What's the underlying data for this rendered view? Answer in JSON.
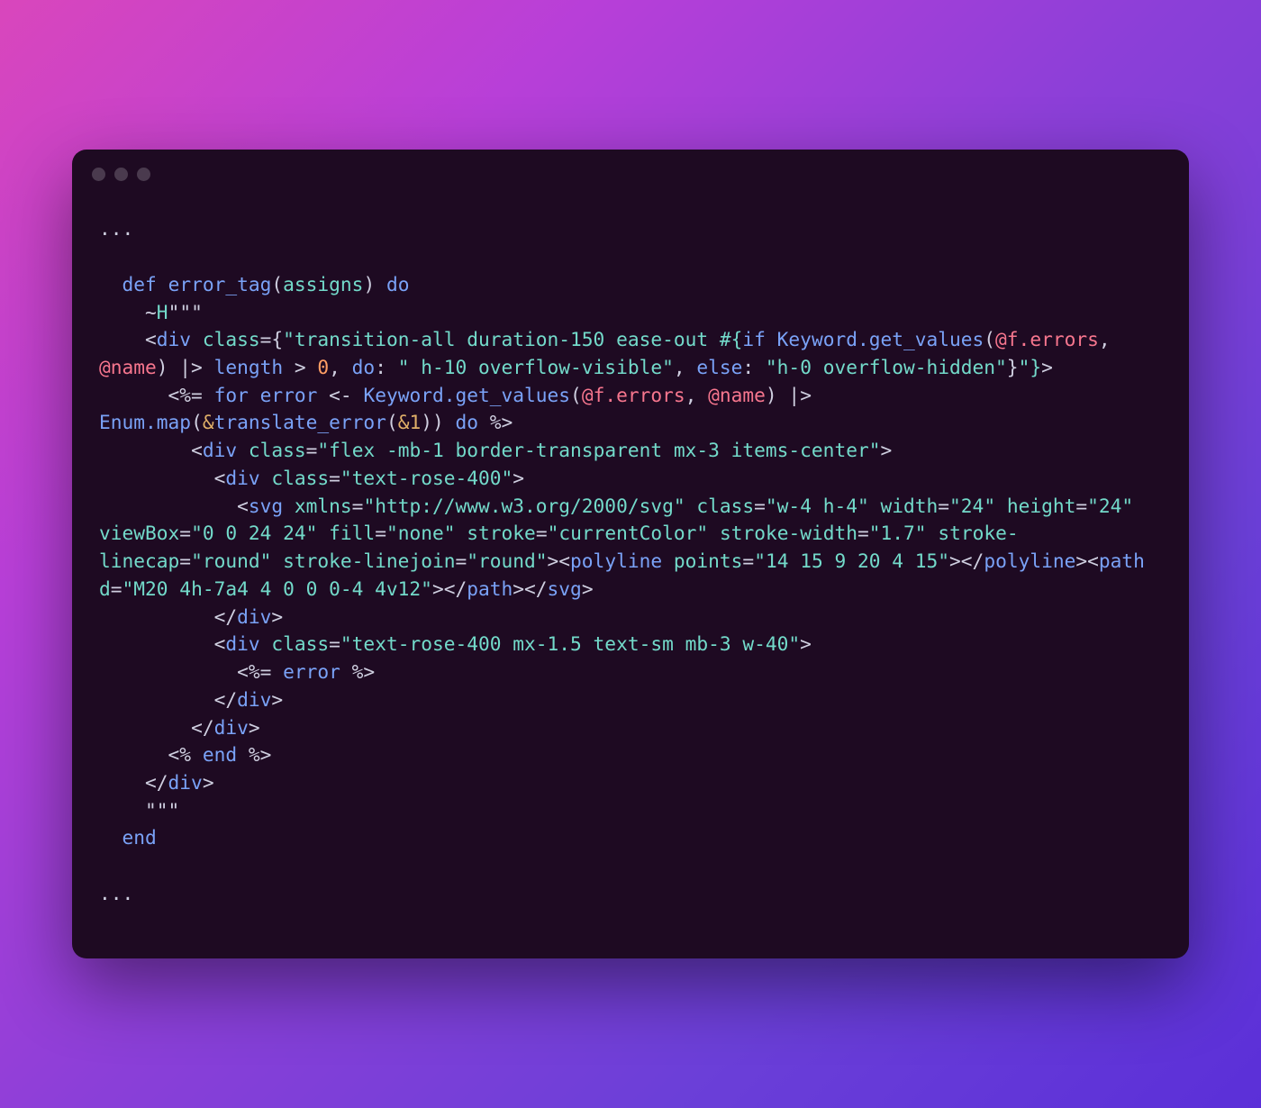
{
  "window": {
    "trafficLights": 3
  },
  "code": {
    "tokens": [
      {
        "t": "...",
        "c": "cmt"
      },
      {
        "t": "\n\n",
        "c": "pl"
      },
      {
        "t": "  ",
        "c": "pl"
      },
      {
        "t": "def",
        "c": "kw"
      },
      {
        "t": " ",
        "c": "pl"
      },
      {
        "t": "error_tag",
        "c": "fn"
      },
      {
        "t": "(",
        "c": "pun"
      },
      {
        "t": "assigns",
        "c": "str"
      },
      {
        "t": ") ",
        "c": "pun"
      },
      {
        "t": "do",
        "c": "kw"
      },
      {
        "t": "\n",
        "c": "pl"
      },
      {
        "t": "    ~",
        "c": "pl"
      },
      {
        "t": "H",
        "c": "str"
      },
      {
        "t": "\"\"\"",
        "c": "pl"
      },
      {
        "t": "\n",
        "c": "pl"
      },
      {
        "t": "    <",
        "c": "pun"
      },
      {
        "t": "div",
        "c": "tag"
      },
      {
        "t": " ",
        "c": "pl"
      },
      {
        "t": "class",
        "c": "str"
      },
      {
        "t": "={",
        "c": "pun"
      },
      {
        "t": "\"transition-all duration-150 ease-out #{",
        "c": "str"
      },
      {
        "t": "if",
        "c": "kw"
      },
      {
        "t": " ",
        "c": "pl"
      },
      {
        "t": "Keyword.get_values",
        "c": "fn"
      },
      {
        "t": "(",
        "c": "pun"
      },
      {
        "t": "@f.errors",
        "c": "at"
      },
      {
        "t": ", ",
        "c": "pun"
      },
      {
        "t": "@name",
        "c": "at"
      },
      {
        "t": ") |> ",
        "c": "pun"
      },
      {
        "t": "length",
        "c": "fn"
      },
      {
        "t": " > ",
        "c": "pun"
      },
      {
        "t": "0",
        "c": "num"
      },
      {
        "t": ", ",
        "c": "pun"
      },
      {
        "t": "do",
        "c": "kw"
      },
      {
        "t": ": ",
        "c": "pun"
      },
      {
        "t": "\" h-10 overflow-visible\"",
        "c": "str"
      },
      {
        "t": ", ",
        "c": "pun"
      },
      {
        "t": "else",
        "c": "kw"
      },
      {
        "t": ": ",
        "c": "pun"
      },
      {
        "t": "\"h-0 overflow-hidden\"",
        "c": "str"
      },
      {
        "t": "}",
        "c": "pun"
      },
      {
        "t": "\"}",
        "c": "str"
      },
      {
        "t": ">",
        "c": "pun"
      },
      {
        "t": "\n",
        "c": "pl"
      },
      {
        "t": "      <%= ",
        "c": "pun"
      },
      {
        "t": "for",
        "c": "kw"
      },
      {
        "t": " ",
        "c": "pl"
      },
      {
        "t": "error",
        "c": "fn"
      },
      {
        "t": " <- ",
        "c": "pun"
      },
      {
        "t": "Keyword.get_values",
        "c": "fn"
      },
      {
        "t": "(",
        "c": "pun"
      },
      {
        "t": "@f.errors",
        "c": "at"
      },
      {
        "t": ", ",
        "c": "pun"
      },
      {
        "t": "@name",
        "c": "at"
      },
      {
        "t": ") |> ",
        "c": "pun"
      },
      {
        "t": "Enum.map",
        "c": "fn"
      },
      {
        "t": "(",
        "c": "pun"
      },
      {
        "t": "&",
        "c": "amp"
      },
      {
        "t": "translate_error",
        "c": "fn"
      },
      {
        "t": "(",
        "c": "pun"
      },
      {
        "t": "&1",
        "c": "amp"
      },
      {
        "t": ")) ",
        "c": "pun"
      },
      {
        "t": "do",
        "c": "kw"
      },
      {
        "t": " %>",
        "c": "pun"
      },
      {
        "t": "\n",
        "c": "pl"
      },
      {
        "t": "        <",
        "c": "pun"
      },
      {
        "t": "div",
        "c": "tag"
      },
      {
        "t": " ",
        "c": "pl"
      },
      {
        "t": "class",
        "c": "str"
      },
      {
        "t": "=",
        "c": "pun"
      },
      {
        "t": "\"flex -mb-1 border-transparent mx-3 items-center\"",
        "c": "str"
      },
      {
        "t": ">",
        "c": "pun"
      },
      {
        "t": "\n",
        "c": "pl"
      },
      {
        "t": "          <",
        "c": "pun"
      },
      {
        "t": "div",
        "c": "tag"
      },
      {
        "t": " ",
        "c": "pl"
      },
      {
        "t": "class",
        "c": "str"
      },
      {
        "t": "=",
        "c": "pun"
      },
      {
        "t": "\"text-rose-400\"",
        "c": "str"
      },
      {
        "t": ">",
        "c": "pun"
      },
      {
        "t": "\n",
        "c": "pl"
      },
      {
        "t": "            <",
        "c": "pun"
      },
      {
        "t": "svg",
        "c": "tag"
      },
      {
        "t": " ",
        "c": "pl"
      },
      {
        "t": "xmlns",
        "c": "str"
      },
      {
        "t": "=",
        "c": "pun"
      },
      {
        "t": "\"http://www.w3.org/2000/svg\"",
        "c": "str"
      },
      {
        "t": " ",
        "c": "pl"
      },
      {
        "t": "class",
        "c": "str"
      },
      {
        "t": "=",
        "c": "pun"
      },
      {
        "t": "\"w-4 h-4\"",
        "c": "str"
      },
      {
        "t": " ",
        "c": "pl"
      },
      {
        "t": "width",
        "c": "str"
      },
      {
        "t": "=",
        "c": "pun"
      },
      {
        "t": "\"24\"",
        "c": "str"
      },
      {
        "t": " ",
        "c": "pl"
      },
      {
        "t": "height",
        "c": "str"
      },
      {
        "t": "=",
        "c": "pun"
      },
      {
        "t": "\"24\"",
        "c": "str"
      },
      {
        "t": " ",
        "c": "pl"
      },
      {
        "t": "viewBox",
        "c": "str"
      },
      {
        "t": "=",
        "c": "pun"
      },
      {
        "t": "\"0 0 24 24\"",
        "c": "str"
      },
      {
        "t": " ",
        "c": "pl"
      },
      {
        "t": "fill",
        "c": "str"
      },
      {
        "t": "=",
        "c": "pun"
      },
      {
        "t": "\"none\"",
        "c": "str"
      },
      {
        "t": " ",
        "c": "pl"
      },
      {
        "t": "stroke",
        "c": "str"
      },
      {
        "t": "=",
        "c": "pun"
      },
      {
        "t": "\"currentColor\"",
        "c": "str"
      },
      {
        "t": " ",
        "c": "pl"
      },
      {
        "t": "stroke-width",
        "c": "str"
      },
      {
        "t": "=",
        "c": "pun"
      },
      {
        "t": "\"1.7\"",
        "c": "str"
      },
      {
        "t": " ",
        "c": "pl"
      },
      {
        "t": "stroke-linecap",
        "c": "str"
      },
      {
        "t": "=",
        "c": "pun"
      },
      {
        "t": "\"round\"",
        "c": "str"
      },
      {
        "t": " ",
        "c": "pl"
      },
      {
        "t": "stroke-linejoin",
        "c": "str"
      },
      {
        "t": "=",
        "c": "pun"
      },
      {
        "t": "\"round\"",
        "c": "str"
      },
      {
        "t": "><",
        "c": "pun"
      },
      {
        "t": "polyline",
        "c": "tag"
      },
      {
        "t": " ",
        "c": "pl"
      },
      {
        "t": "points",
        "c": "str"
      },
      {
        "t": "=",
        "c": "pun"
      },
      {
        "t": "\"14 15 9 20 4 15\"",
        "c": "str"
      },
      {
        "t": "></",
        "c": "pun"
      },
      {
        "t": "polyline",
        "c": "tag"
      },
      {
        "t": "><",
        "c": "pun"
      },
      {
        "t": "path",
        "c": "tag"
      },
      {
        "t": " ",
        "c": "pl"
      },
      {
        "t": "d",
        "c": "str"
      },
      {
        "t": "=",
        "c": "pun"
      },
      {
        "t": "\"M20 4h-7a4 4 0 0 0-4 4v12\"",
        "c": "str"
      },
      {
        "t": "></",
        "c": "pun"
      },
      {
        "t": "path",
        "c": "tag"
      },
      {
        "t": "></",
        "c": "pun"
      },
      {
        "t": "svg",
        "c": "tag"
      },
      {
        "t": ">",
        "c": "pun"
      },
      {
        "t": "\n",
        "c": "pl"
      },
      {
        "t": "          </",
        "c": "pun"
      },
      {
        "t": "div",
        "c": "tag"
      },
      {
        "t": ">",
        "c": "pun"
      },
      {
        "t": "\n",
        "c": "pl"
      },
      {
        "t": "          <",
        "c": "pun"
      },
      {
        "t": "div",
        "c": "tag"
      },
      {
        "t": " ",
        "c": "pl"
      },
      {
        "t": "class",
        "c": "str"
      },
      {
        "t": "=",
        "c": "pun"
      },
      {
        "t": "\"text-rose-400 mx-1.5 text-sm mb-3 w-40\"",
        "c": "str"
      },
      {
        "t": ">",
        "c": "pun"
      },
      {
        "t": "\n",
        "c": "pl"
      },
      {
        "t": "            <%= ",
        "c": "pun"
      },
      {
        "t": "error",
        "c": "fn"
      },
      {
        "t": " %>",
        "c": "pun"
      },
      {
        "t": "\n",
        "c": "pl"
      },
      {
        "t": "          </",
        "c": "pun"
      },
      {
        "t": "div",
        "c": "tag"
      },
      {
        "t": ">",
        "c": "pun"
      },
      {
        "t": "\n",
        "c": "pl"
      },
      {
        "t": "        </",
        "c": "pun"
      },
      {
        "t": "div",
        "c": "tag"
      },
      {
        "t": ">",
        "c": "pun"
      },
      {
        "t": "\n",
        "c": "pl"
      },
      {
        "t": "      <% ",
        "c": "pun"
      },
      {
        "t": "end",
        "c": "kw"
      },
      {
        "t": " %>",
        "c": "pun"
      },
      {
        "t": "\n",
        "c": "pl"
      },
      {
        "t": "    </",
        "c": "pun"
      },
      {
        "t": "div",
        "c": "tag"
      },
      {
        "t": ">",
        "c": "pun"
      },
      {
        "t": "\n",
        "c": "pl"
      },
      {
        "t": "    \"\"\"",
        "c": "pl"
      },
      {
        "t": "\n",
        "c": "pl"
      },
      {
        "t": "  ",
        "c": "pl"
      },
      {
        "t": "end",
        "c": "kw"
      },
      {
        "t": "\n\n",
        "c": "pl"
      },
      {
        "t": "...",
        "c": "cmt"
      }
    ]
  }
}
